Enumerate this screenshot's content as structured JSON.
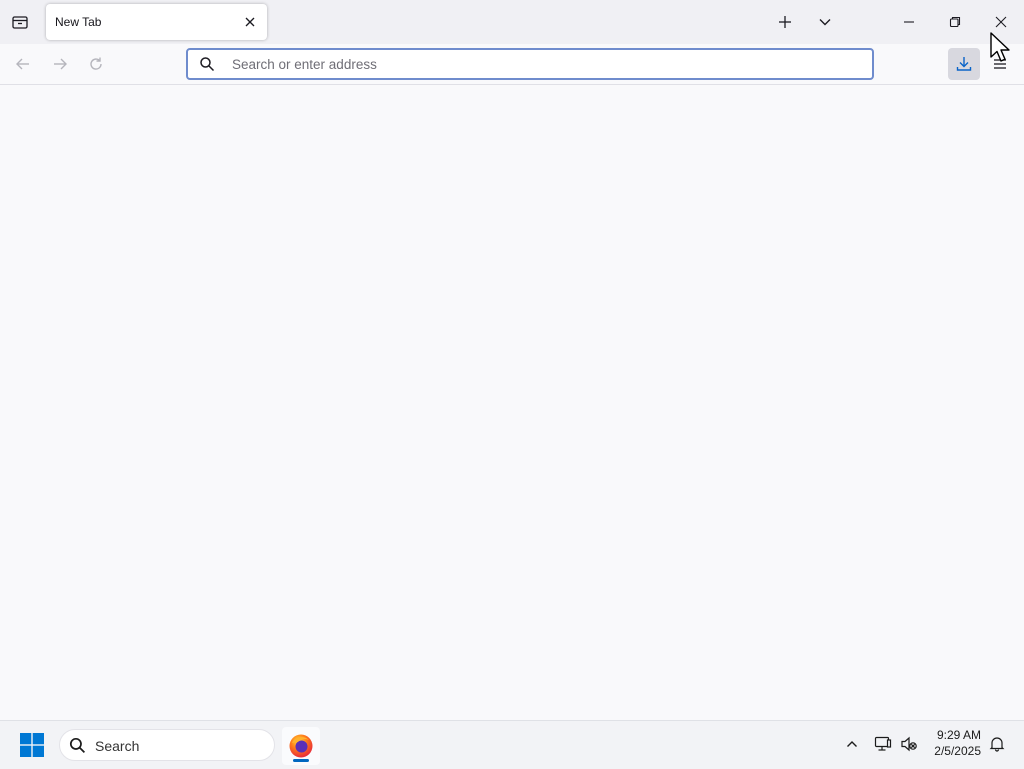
{
  "browser": {
    "tabs": [
      {
        "title": "New Tab"
      }
    ],
    "urlbar": {
      "placeholder": "Search or enter address",
      "value": ""
    },
    "colors": {
      "focus_ring": "#6f8ccd",
      "tab_strip_bg": "#f0f0f4",
      "content_bg": "#f9f9fb"
    },
    "icons": {
      "tab_list": "tab-list-icon",
      "tab_close": "close-icon",
      "new_tab": "plus-icon",
      "all_tabs": "chevron-down-icon",
      "minimize": "minimize-icon",
      "restore": "restore-icon",
      "close_window": "close-icon",
      "back": "back-arrow-icon",
      "forward": "forward-arrow-icon",
      "reload": "reload-icon",
      "url_search": "search-icon",
      "downloads": "download-icon",
      "menu": "hamburger-menu-icon"
    }
  },
  "taskbar": {
    "search_label": "Search",
    "pinned_apps": [
      "firefox"
    ],
    "clock": {
      "time": "9:29 AM",
      "date": "2/5/2025"
    },
    "colors": {
      "start_blue": "#0078d4",
      "active_indicator": "#0067c0"
    }
  }
}
